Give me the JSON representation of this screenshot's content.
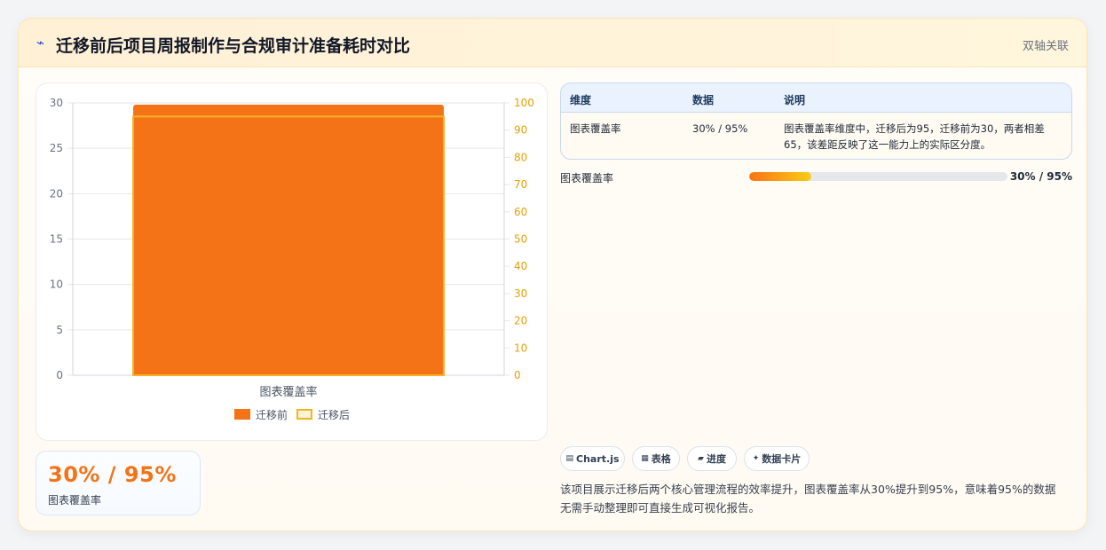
{
  "header": {
    "icon": "chart-trend-icon",
    "title": "迁移前后项目周报制作与合规审计准备耗时对比",
    "tag": "双轴关联"
  },
  "chart_data": {
    "type": "bar",
    "categories": [
      "图表覆盖率"
    ],
    "series": [
      {
        "name": "迁移前",
        "values": [
          30
        ],
        "axis": "left",
        "color": "#f47317",
        "style": "filled"
      },
      {
        "name": "迁移后",
        "values": [
          95
        ],
        "axis": "right",
        "color": "#f5b225",
        "style": "outline"
      }
    ],
    "y_left": {
      "range": [
        0,
        30
      ],
      "ticks": [
        "0",
        "5",
        "10",
        "15",
        "20",
        "25",
        "30"
      ],
      "color": "#6b7280"
    },
    "y_right": {
      "range": [
        0,
        100
      ],
      "ticks": [
        "0",
        "10",
        "20",
        "30",
        "40",
        "50",
        "60",
        "70",
        "80",
        "90",
        "100"
      ],
      "color": "#e3a008"
    },
    "grid": true,
    "legend_placement": "bottom"
  },
  "stat_card": {
    "value": "30% / 95%",
    "label": "图表覆盖率"
  },
  "table": {
    "headers": [
      "维度",
      "数据",
      "说明"
    ],
    "row": {
      "dimension": "图表覆盖率",
      "data": "30% / 95%",
      "desc_line1": "图表覆盖率维度中，迁移后为95，迁移前为30，两者相差",
      "desc_line2": "65，该差距反映了这一能力上的实际区分度。"
    }
  },
  "progress": {
    "label": "图表覆盖率",
    "value_text": "30% / 95%",
    "fraction": 0.24
  },
  "pills": [
    {
      "icon": "chart-icon",
      "glyph": "▤",
      "label": "Chart.js"
    },
    {
      "icon": "table-icon",
      "glyph": "▦",
      "label": "表格"
    },
    {
      "icon": "progress-icon",
      "glyph": "▰",
      "label": "进度"
    },
    {
      "icon": "sparkle-icon",
      "glyph": "✦",
      "label": "数据卡片"
    }
  ],
  "summary": {
    "line1": "该项目展示迁移后两个核心管理流程的效率提升，图表覆盖率从30%提升到95%，意味着95%的数据",
    "line2": "无需手动整理即可直接生成可视化报告。"
  }
}
